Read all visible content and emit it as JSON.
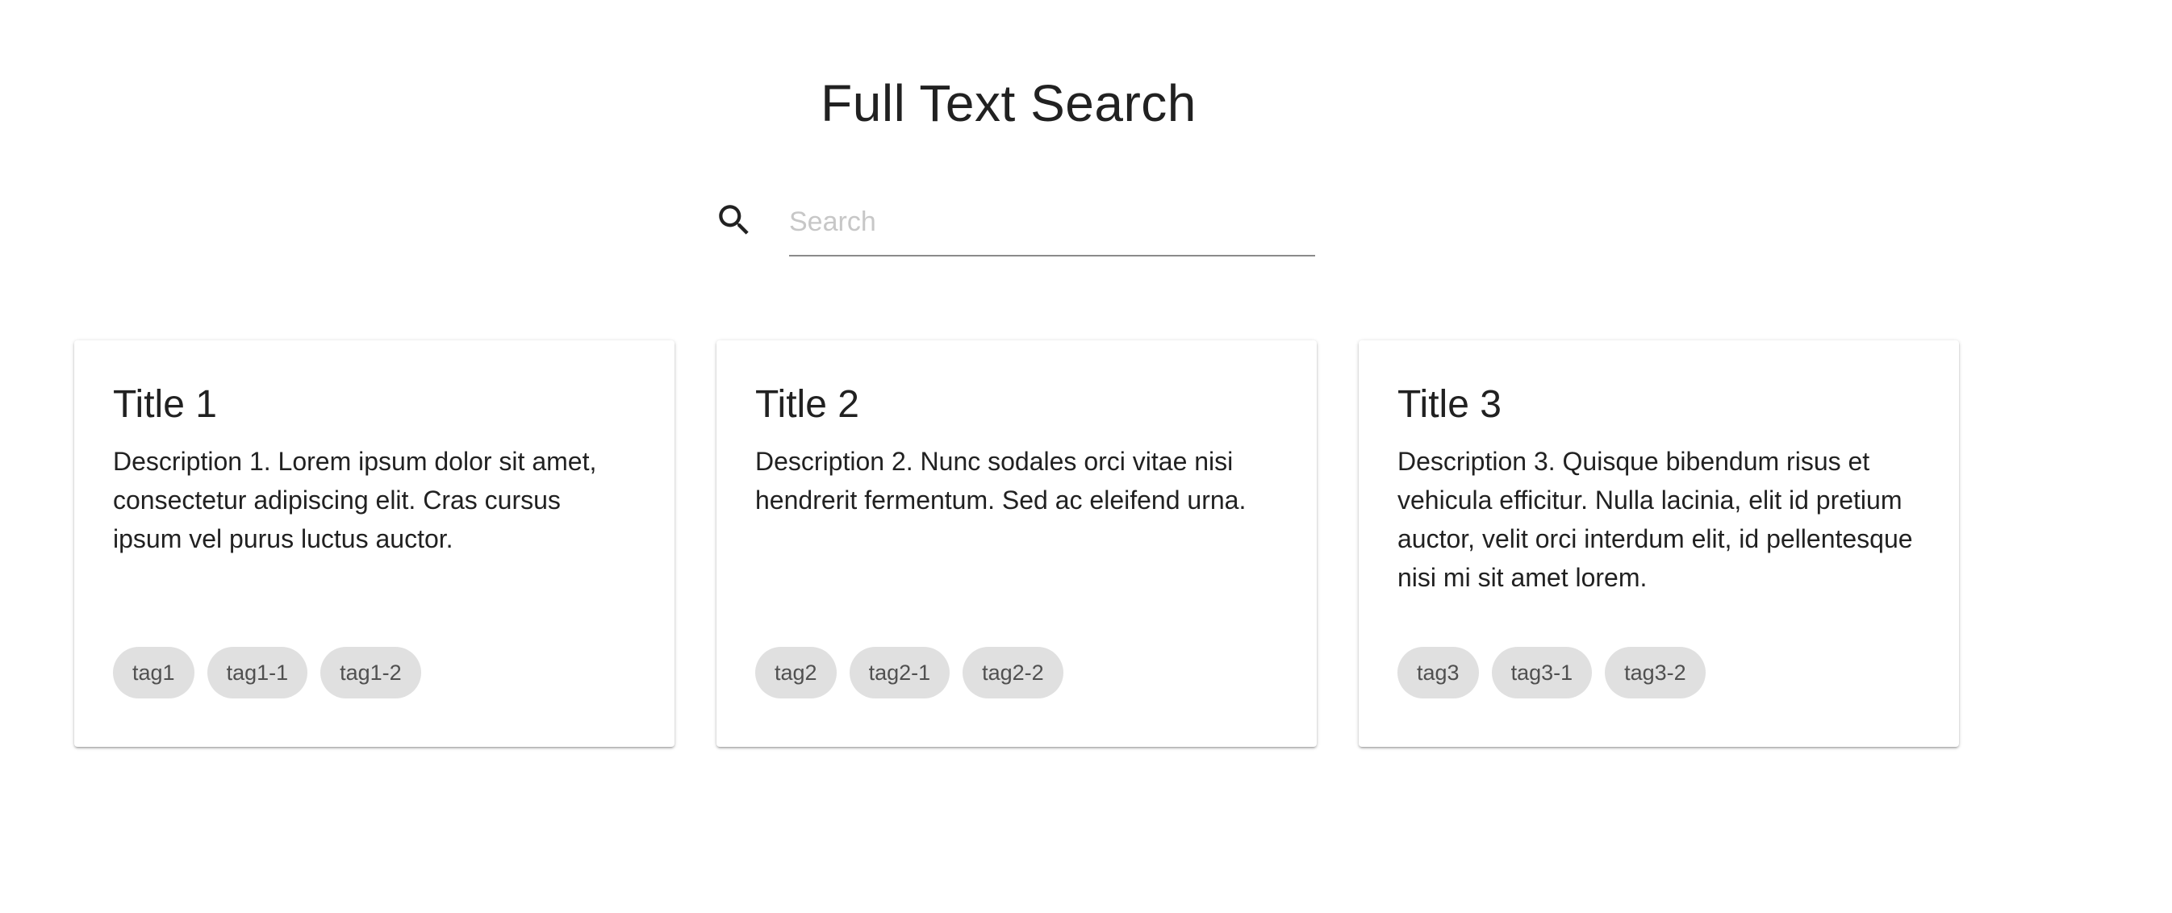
{
  "header": {
    "title": "Full Text Search"
  },
  "search": {
    "icon": "search-icon",
    "placeholder": "Search",
    "value": ""
  },
  "cards": [
    {
      "title": "Title 1",
      "description": "Description 1. Lorem ipsum dolor sit amet, consectetur adipiscing elit. Cras cursus ipsum vel purus luctus auctor.",
      "tags": [
        "tag1",
        "tag1-1",
        "tag1-2"
      ]
    },
    {
      "title": "Title 2",
      "description": "Description 2. Nunc sodales orci vitae nisi hendrerit fermentum. Sed ac eleifend urna.",
      "tags": [
        "tag2",
        "tag2-1",
        "tag2-2"
      ]
    },
    {
      "title": "Title 3",
      "description": "Description 3. Quisque bibendum risus et vehicula efficitur. Nulla lacinia, elit id pretium auctor, velit orci interdum elit, id pellentesque nisi mi sit amet lorem.",
      "tags": [
        "tag3",
        "tag3-1",
        "tag3-2"
      ]
    }
  ],
  "colors": {
    "chip_background": "#e0e0e0",
    "chip_text": "#505050",
    "text": "#212121",
    "input_underline": "#8a8a8a"
  }
}
